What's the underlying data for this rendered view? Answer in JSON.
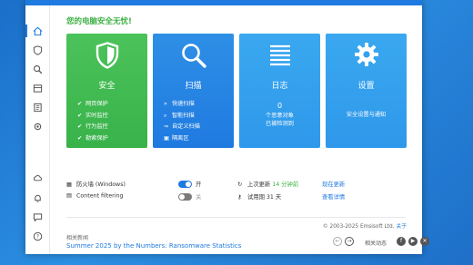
{
  "status_text": "您的电脑安全无忧!",
  "tiles": [
    {
      "title": "安全",
      "icon": "shield-icon",
      "items": [
        "网页保护",
        "实时监控",
        "行为监控",
        "勒索保护"
      ]
    },
    {
      "title": "扫描",
      "icon": "magnifier-icon",
      "items": [
        "快速扫描",
        "智能扫描",
        "自定义扫描",
        "隔离区"
      ]
    },
    {
      "title": "日志",
      "icon": "log-list-icon",
      "count": "0",
      "line1": "个恶意对象",
      "line2": "已被检测到"
    },
    {
      "title": "设置",
      "icon": "gear-icon",
      "line1": "安全设置与通知"
    }
  ],
  "firewall": {
    "label": "防火墙 (Windows)",
    "state": "开"
  },
  "content_filtering": {
    "label": "Content filtering",
    "state": "关"
  },
  "last_update": {
    "label": "上次更新",
    "value": "14 分钟前",
    "action": "现在更新"
  },
  "trial": {
    "label": "试用期 31 天",
    "action": "查看详情"
  },
  "copyright": {
    "text": "© 2003-2025 Emsisoft Ltd.",
    "link": "关于"
  },
  "news": {
    "label": "相关新闻",
    "title": "Summer 2025 by the Numbers: Ransomware Statistics"
  },
  "social": {
    "label": "相关动态"
  },
  "colors": {
    "accent": "#1f7ae0",
    "safe_green": "#3cb043"
  }
}
